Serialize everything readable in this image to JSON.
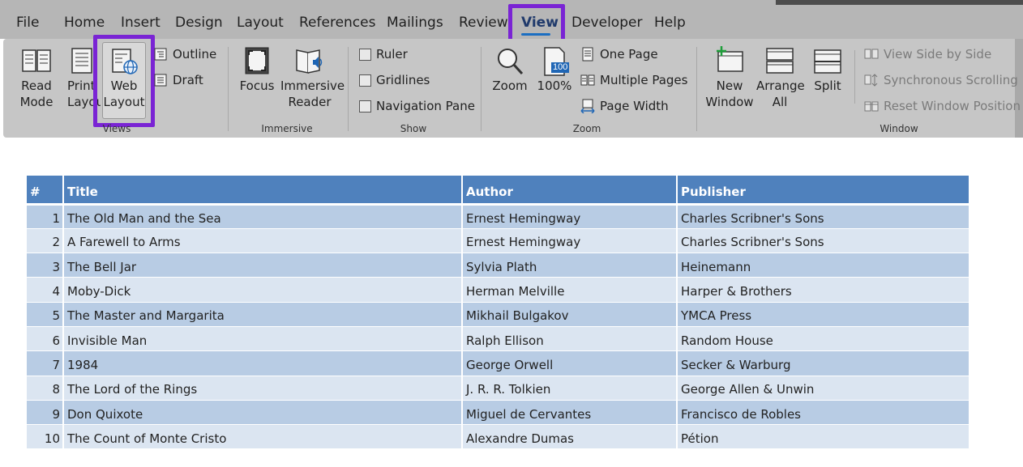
{
  "menu": {
    "tabs": [
      "File",
      "Home",
      "Insert",
      "Design",
      "Layout",
      "References",
      "Mailings",
      "Review",
      "View",
      "Developer",
      "Help"
    ],
    "active": "View"
  },
  "ribbon": {
    "views": {
      "label": "Views",
      "read_mode": [
        "Read",
        "Mode"
      ],
      "print_layout": [
        "Print",
        "Layout"
      ],
      "web_layout": [
        "Web",
        "Layout"
      ],
      "outline": "Outline",
      "draft": "Draft"
    },
    "immersive": {
      "label": "Immersive",
      "focus": "Focus",
      "immersive_reader": [
        "Immersive",
        "Reader"
      ]
    },
    "show": {
      "label": "Show",
      "ruler": "Ruler",
      "gridlines": "Gridlines",
      "navigation_pane": "Navigation Pane"
    },
    "zoom": {
      "label": "Zoom",
      "zoom": "Zoom",
      "hundred_badge": "100",
      "hundred": "100%",
      "one_page": "One Page",
      "multiple_pages": "Multiple Pages",
      "page_width": "Page Width"
    },
    "window": {
      "label": "Window",
      "new_window": [
        "New",
        "Window"
      ],
      "arrange_all": [
        "Arrange",
        "All"
      ],
      "split": "Split",
      "view_side_by_side": "View Side by Side",
      "synchronous_scrolling": "Synchronous Scrolling",
      "reset_window_position": "Reset Window Position"
    }
  },
  "table": {
    "headers": [
      "#",
      "Title",
      "Author",
      "Publisher"
    ],
    "rows": [
      [
        "1",
        "The Old Man and the Sea",
        "Ernest Hemingway",
        "Charles Scribner's Sons"
      ],
      [
        "2",
        "A Farewell to Arms",
        "Ernest Hemingway",
        "Charles Scribner's Sons"
      ],
      [
        "3",
        "The Bell Jar",
        "Sylvia Plath",
        "Heinemann"
      ],
      [
        "4",
        "Moby-Dick",
        "Herman Melville",
        "Harper & Brothers"
      ],
      [
        "5",
        "The Master and Margarita",
        "Mikhail Bulgakov",
        "YMCA Press"
      ],
      [
        "6",
        "Invisible Man",
        "Ralph Ellison",
        "Random House"
      ],
      [
        "7",
        "1984",
        "George Orwell",
        "Secker & Warburg"
      ],
      [
        "8",
        "The Lord of the Rings",
        "J. R. R. Tolkien",
        "George Allen & Unwin"
      ],
      [
        "9",
        "Don Quixote",
        "Miguel de Cervantes",
        "Francisco de Robles"
      ],
      [
        "10",
        "The Count of Monte Cristo",
        "Alexandre Dumas",
        "Pétion"
      ]
    ]
  },
  "colors": {
    "highlight": "#7a24d4",
    "table_header": "#4f81bd",
    "row_odd": "#b8cce4",
    "row_even": "#dbe5f1",
    "active_tab_underline": "#1b6ec2"
  }
}
